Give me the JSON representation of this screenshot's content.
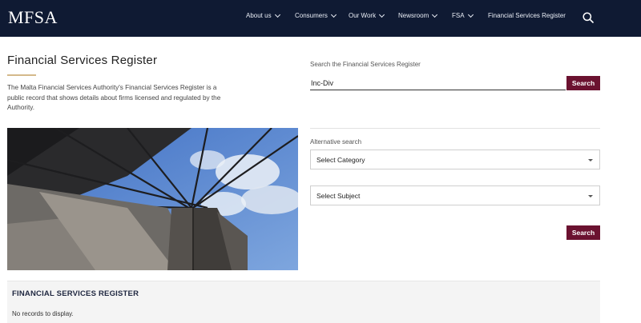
{
  "header": {
    "logo": "MFSA",
    "nav": [
      {
        "label": "About us",
        "has_dropdown": true
      },
      {
        "label": "Consumers",
        "has_dropdown": true
      },
      {
        "label": "Our Work",
        "has_dropdown": true
      },
      {
        "label": "Newsroom",
        "has_dropdown": true
      },
      {
        "label": "FSA",
        "has_dropdown": true
      },
      {
        "label": "Financial Services Register",
        "has_dropdown": false
      }
    ],
    "search_icon": "search-icon",
    "background_color": "#0f1a33"
  },
  "intro": {
    "title": "Financial Services Register",
    "description": "The Malta Financial Services Authority's Financial Services Register is a public record that shows details about firms licensed and regulated by the Authority."
  },
  "search": {
    "label": "Search the Financial Services Register",
    "value": "Inc-Div",
    "button_label": "Search"
  },
  "alternative": {
    "label": "Alternative search",
    "category_placeholder": "Select Category",
    "subject_placeholder": "Select Subject",
    "button_label": "Search"
  },
  "results": {
    "title": "FINANCIAL SERVICES REGISTER",
    "empty_message": "No records to display."
  },
  "colors": {
    "accent": "#6b1230",
    "underline": "#d4b98a"
  }
}
